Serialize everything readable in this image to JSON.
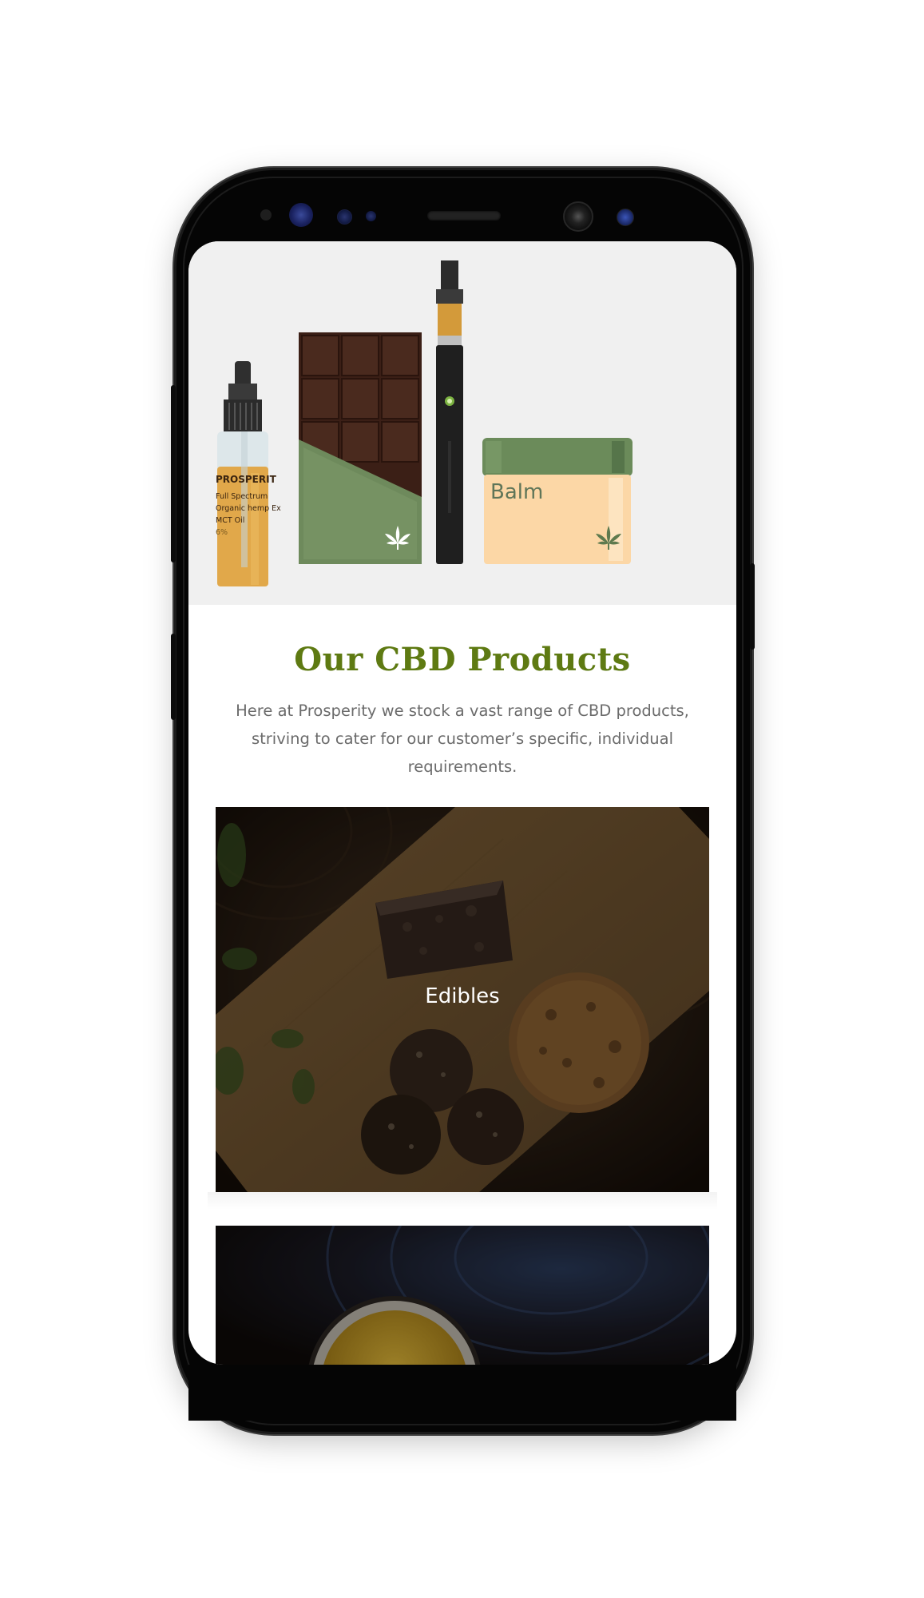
{
  "hero": {
    "oil_bottle_brand": "PROSPERIT",
    "oil_bottle_lines": [
      "Full Spectrum",
      "Organic hemp Ex",
      "MCT Oil",
      "6%"
    ],
    "balm_label": "Balm"
  },
  "section": {
    "title": "Our CBD Products",
    "description": "Here at Prosperity we stock a vast range of CBD products, striving to cater for our customer’s specific, individual requirements."
  },
  "products": [
    {
      "label": "Edibles"
    }
  ],
  "colors": {
    "title_green": "#5e7a12",
    "hero_bg": "#f0f0f0",
    "chocolate_wrapper": "#6e8a5c",
    "balm_lid": "#6b8b5a",
    "balm_jar": "#fcd7a6",
    "oil_label": "#e1a84a"
  },
  "icons": [
    "cannabis-leaf-icon"
  ]
}
